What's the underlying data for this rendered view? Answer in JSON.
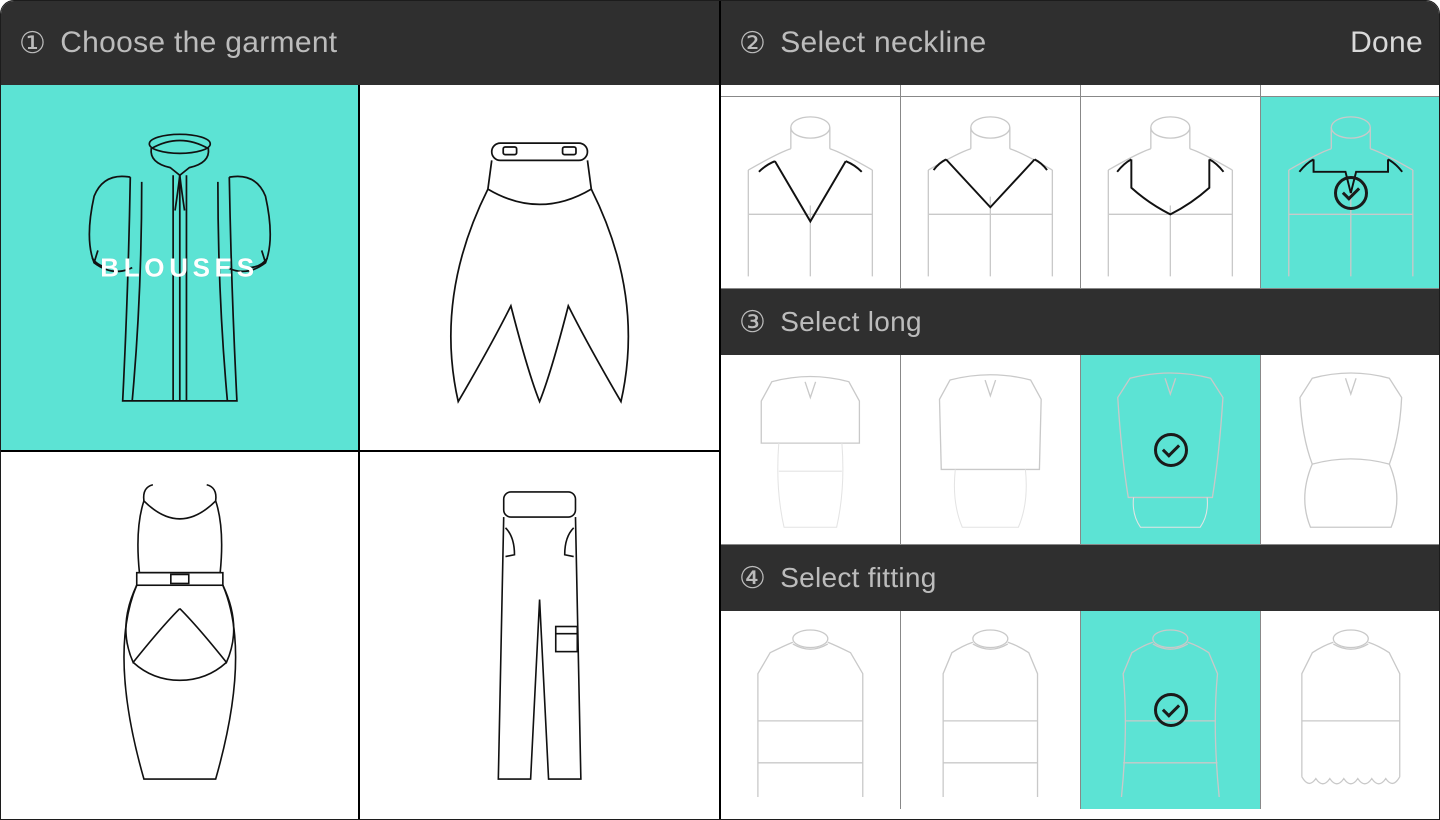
{
  "steps": {
    "garment": {
      "num": "①",
      "title": "Choose the garment"
    },
    "neckline": {
      "num": "②",
      "title": "Select neckline",
      "done_label": "Done"
    },
    "long": {
      "num": "③",
      "title": "Select long"
    },
    "fitting": {
      "num": "④",
      "title": "Select fitting"
    }
  },
  "garments": {
    "items": [
      {
        "id": "blouses",
        "label": "BLOUSES",
        "selected": true
      },
      {
        "id": "skirts",
        "label": "",
        "selected": false
      },
      {
        "id": "dresses",
        "label": "",
        "selected": false
      },
      {
        "id": "pants",
        "label": "",
        "selected": false
      }
    ]
  },
  "neckline": {
    "options": [
      {
        "id": "v-neck-deep",
        "selected": false
      },
      {
        "id": "v-neck-wide",
        "selected": false
      },
      {
        "id": "sweetheart",
        "selected": false
      },
      {
        "id": "straight-slit",
        "selected": true
      }
    ]
  },
  "long": {
    "options": [
      {
        "id": "crop",
        "selected": false
      },
      {
        "id": "waist",
        "selected": false
      },
      {
        "id": "hip",
        "selected": true
      },
      {
        "id": "peplum",
        "selected": false
      }
    ]
  },
  "fitting": {
    "options": [
      {
        "id": "loose",
        "selected": false
      },
      {
        "id": "straight",
        "selected": false
      },
      {
        "id": "fitted",
        "selected": true
      },
      {
        "id": "gathered",
        "selected": false
      }
    ]
  },
  "colors": {
    "accent": "#5ce3d4"
  }
}
